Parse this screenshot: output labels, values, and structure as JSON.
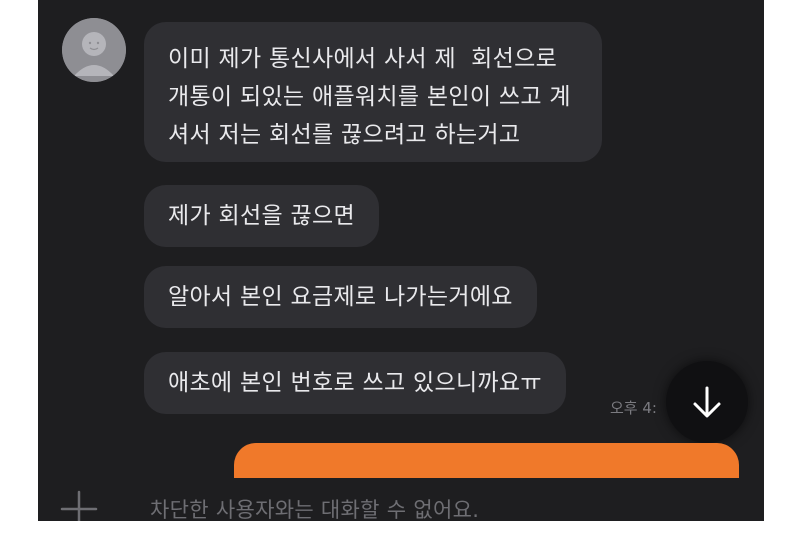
{
  "messages": [
    {
      "text": "이미 제가 통신사에서 사서 제  회선으로\n개통이 되있는 애플워치를 본인이 쓰고 계\n셔서 저는 회선를 끊으려고 하는거고"
    },
    {
      "text": "제가 회선을 끊으면"
    },
    {
      "text": "알아서 본인 요금제로 나가는거에요"
    },
    {
      "text": "애초에 본인 번호로 쓰고 있으니까요ㅠ"
    }
  ],
  "timestamp": "오후 4:",
  "input": {
    "blocked_notice": "차단한 사용자와는 대화할 수 없어요."
  },
  "colors": {
    "background": "#1e1e20",
    "bubble": "#2f2f33",
    "sent_bubble": "#f0792a"
  },
  "icons": {
    "avatar": "default-profile-icon",
    "scroll": "arrow-down-icon",
    "attach": "plus-icon"
  }
}
